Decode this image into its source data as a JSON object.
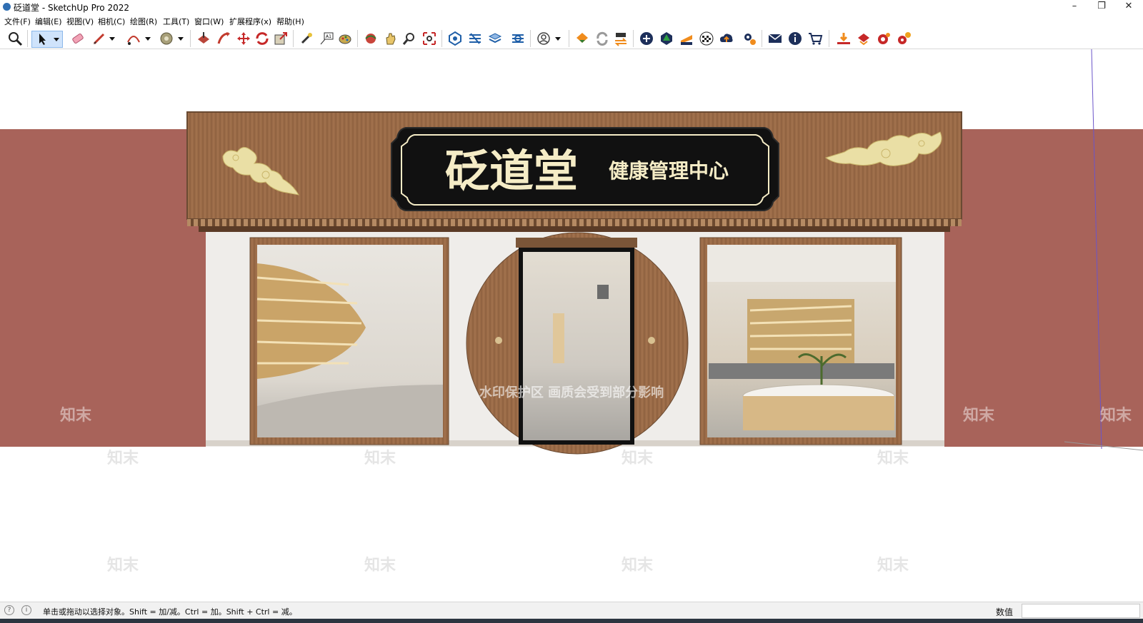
{
  "window": {
    "title": "砭道堂 - SketchUp Pro 2022",
    "minimize": "–",
    "restore": "❐",
    "close": "✕"
  },
  "menu": [
    "文件(F)",
    "编辑(E)",
    "视图(V)",
    "相机(C)",
    "绘图(R)",
    "工具(T)",
    "窗口(W)",
    "扩展程序(x)",
    "帮助(H)"
  ],
  "toolbar_icons": [
    "zoom-extents",
    "select",
    "eraser",
    "pencil",
    "arc",
    "paint-bucket",
    "push-pull",
    "follow-me",
    "move",
    "rotate",
    "scale",
    "tape-measure",
    "text",
    "paint",
    "orbit",
    "pan",
    "zoom",
    "zoom-window",
    "components",
    "layers",
    "styles",
    "scenes",
    "user-account",
    "extension-warehouse",
    "refresh",
    "transfer",
    "add",
    "tree",
    "section",
    "checker",
    "cloud-upload",
    "settings",
    "mail",
    "info",
    "cart",
    "plugin-1",
    "plugin-2",
    "plugin-3",
    "plugin-4"
  ],
  "scene": {
    "brand_name": "砭道堂",
    "subtitle": "健康管理中心",
    "watermark_notice": "水印保护区  画质会受到部分影响",
    "watermark_brand": "知末",
    "colors": {
      "wall": "#a8635a",
      "wood": "#9a6b47",
      "sign_bg": "#111111",
      "sign_text": "#f5ecc6",
      "gold": "#eadfa5"
    }
  },
  "status": {
    "hint": "单击或拖动以选择对象。Shift = 加/减。Ctrl = 加。Shift + Ctrl = 减。",
    "value_label": "数值",
    "value": ""
  }
}
